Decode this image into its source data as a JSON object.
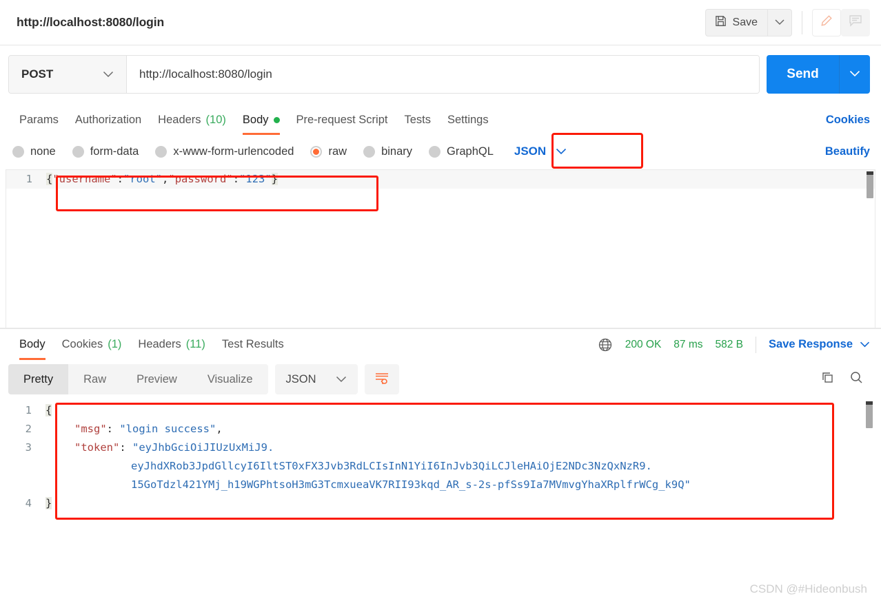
{
  "window": {
    "tab_title": "http://localhost:8080/login",
    "watermark": "CSDN @#Hideonbush"
  },
  "toolbar": {
    "save_label": "Save",
    "save_icon": "floppy-disk-icon",
    "save_caret_icon": "chevron-down-icon",
    "edit_icon": "pencil-icon",
    "comment_icon": "comment-icon"
  },
  "request": {
    "method": "POST",
    "method_caret_icon": "chevron-down-icon",
    "url": "http://localhost:8080/login",
    "send_label": "Send",
    "send_caret_icon": "chevron-down-icon",
    "tabs": [
      {
        "label": "Params",
        "count": "",
        "active": false,
        "dot": false
      },
      {
        "label": "Authorization",
        "count": "",
        "active": false,
        "dot": false
      },
      {
        "label": "Headers",
        "count": "(10)",
        "active": false,
        "dot": false
      },
      {
        "label": "Body",
        "count": "",
        "active": true,
        "dot": true
      },
      {
        "label": "Pre-request Script",
        "count": "",
        "active": false,
        "dot": false
      },
      {
        "label": "Tests",
        "count": "",
        "active": false,
        "dot": false
      },
      {
        "label": "Settings",
        "count": "",
        "active": false,
        "dot": false
      }
    ],
    "cookies_link": "Cookies",
    "body_types": [
      {
        "label": "none",
        "selected": false
      },
      {
        "label": "form-data",
        "selected": false
      },
      {
        "label": "x-www-form-urlencoded",
        "selected": false
      },
      {
        "label": "raw",
        "selected": true
      },
      {
        "label": "binary",
        "selected": false
      },
      {
        "label": "GraphQL",
        "selected": false
      }
    ],
    "raw_format": "JSON",
    "raw_format_caret_icon": "chevron-down-icon",
    "beautify_label": "Beautify",
    "body_lines": [
      {
        "no": "1",
        "tokens": [
          {
            "t": "brace",
            "v": "{"
          },
          {
            "t": "key",
            "v": "\"username\""
          },
          {
            "t": "punc",
            "v": ":"
          },
          {
            "t": "str",
            "v": "\"root\""
          },
          {
            "t": "punc",
            "v": ","
          },
          {
            "t": "key",
            "v": "\"password\""
          },
          {
            "t": "punc",
            "v": ":"
          },
          {
            "t": "str",
            "v": "\"123\""
          },
          {
            "t": "brace",
            "v": "}"
          }
        ]
      }
    ]
  },
  "response": {
    "tabs": [
      {
        "label": "Body",
        "count": "",
        "active": true
      },
      {
        "label": "Cookies",
        "count": "(1)",
        "active": false
      },
      {
        "label": "Headers",
        "count": "(11)",
        "active": false
      },
      {
        "label": "Test Results",
        "count": "",
        "active": false
      }
    ],
    "globe_icon": "globe-icon",
    "status": "200 OK",
    "time": "87 ms",
    "size": "582 B",
    "save_response_label": "Save Response",
    "save_response_caret_icon": "chevron-down-icon",
    "view_modes": [
      {
        "label": "Pretty",
        "active": true
      },
      {
        "label": "Raw",
        "active": false
      },
      {
        "label": "Preview",
        "active": false
      },
      {
        "label": "Visualize",
        "active": false
      }
    ],
    "format": "JSON",
    "format_caret_icon": "chevron-down-icon",
    "wrap_icon": "word-wrap-icon",
    "copy_icon": "copy-icon",
    "search_icon": "search-icon",
    "body_lines": [
      {
        "no": "1",
        "indent": 0,
        "tokens": [
          {
            "t": "brace",
            "v": "{"
          }
        ]
      },
      {
        "no": "2",
        "indent": 1,
        "tokens": [
          {
            "t": "key",
            "v": "\"msg\""
          },
          {
            "t": "punc",
            "v": ": "
          },
          {
            "t": "str",
            "v": "\"login success\""
          },
          {
            "t": "punc",
            "v": ","
          }
        ]
      },
      {
        "no": "3",
        "indent": 1,
        "tokens": [
          {
            "t": "key",
            "v": "\"token\""
          },
          {
            "t": "punc",
            "v": ": "
          },
          {
            "t": "str",
            "v": "\"eyJhbGciOiJIUzUxMiJ9."
          }
        ]
      },
      {
        "no": "",
        "indent": 2,
        "tokens": [
          {
            "t": "str",
            "v": "eyJhdXRob3JpdGllcyI6IltST0xFX3Jvb3RdLCIsInN1YiI6InJvb3QiLCJleHAiOjE2NDc3NzQxNzR9."
          }
        ]
      },
      {
        "no": "",
        "indent": 2,
        "tokens": [
          {
            "t": "str",
            "v": "15GoTdzl421YMj_h19WGPhtsoH3mG3TcmxueaVK7RII93kqd_AR_s-2s-pfSs9Ia7MVmvgYhaXRplfrWCg_k9Q\""
          }
        ]
      },
      {
        "no": "4",
        "indent": 0,
        "tokens": [
          {
            "t": "brace",
            "v": "}"
          }
        ]
      }
    ]
  },
  "colors": {
    "accent_orange": "#ff6c37",
    "link_blue": "#1268d3",
    "send_blue": "#1184ef",
    "status_green": "#27a04b",
    "annotation_red": "#fb1a06",
    "json_key": "#b0413e",
    "json_string": "#2e6db4"
  }
}
